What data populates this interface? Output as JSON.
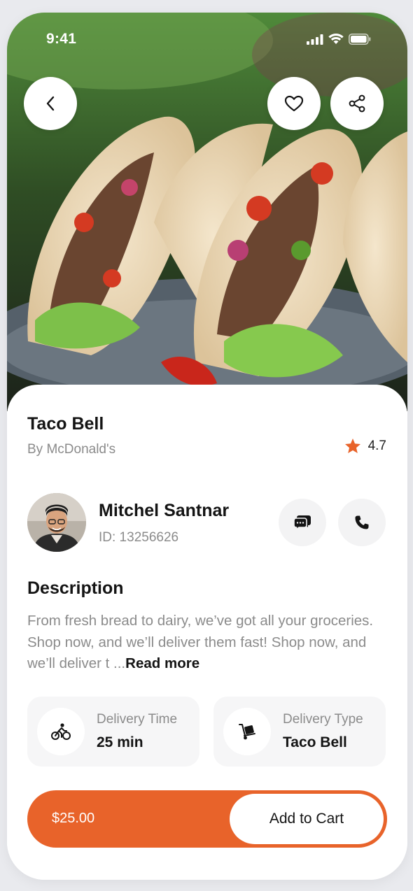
{
  "status_bar": {
    "time": "9:41"
  },
  "product": {
    "title": "Taco Bell",
    "vendor": "By McDonald's",
    "rating": "4.7"
  },
  "driver": {
    "name": "Mitchel Santnar",
    "id": "ID: 13256626"
  },
  "description": {
    "heading": "Description",
    "text": "From fresh bread to dairy, we’ve got all your groceries. Shop now, and we’ll deliver them fast! Shop now, and we’ll deliver t ...",
    "read_more": "Read more"
  },
  "info_cards": [
    {
      "label": "Delivery Time",
      "value": "25 min",
      "icon": "bicycle-icon"
    },
    {
      "label": "Delivery Type",
      "value": "Taco Bell",
      "icon": "hand-truck-icon"
    }
  ],
  "cart": {
    "price": "$25.00",
    "button_label": "Add to Cart"
  },
  "icons": {
    "back": "chevron-left-icon",
    "favorite": "heart-icon",
    "share": "share-icon",
    "chat": "chat-icon",
    "call": "phone-icon",
    "rating": "star-icon"
  },
  "colors": {
    "accent": "#e8632a",
    "text_primary": "#141414",
    "text_secondary": "#8b8b8b",
    "card_bg": "#f6f6f7"
  }
}
